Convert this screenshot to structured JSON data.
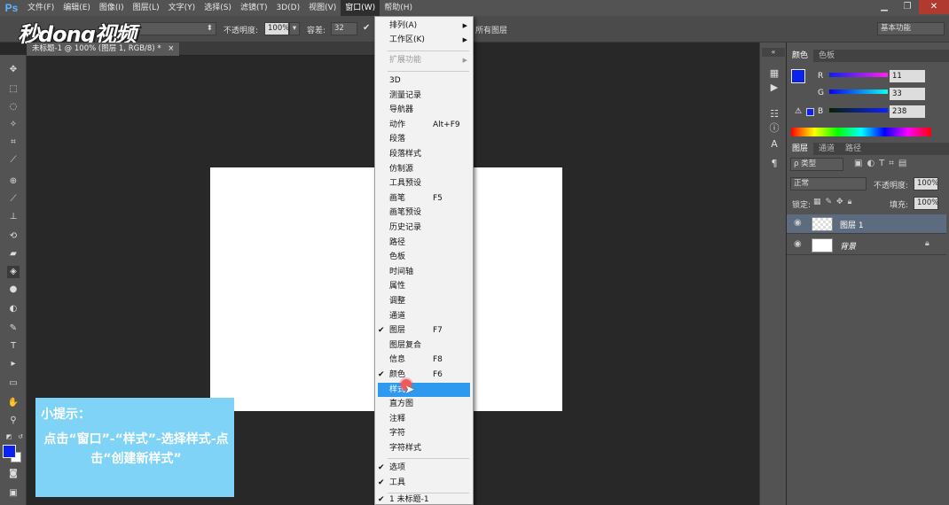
{
  "menubar": {
    "logo": "Ps",
    "items": [
      "文件(F)",
      "编辑(E)",
      "图像(I)",
      "图层(L)",
      "文字(Y)",
      "选择(S)",
      "滤镜(T)",
      "3D(D)",
      "视图(V)",
      "窗口(W)",
      "帮助(H)"
    ],
    "window_controls": [
      "▁",
      "❐",
      "✕"
    ]
  },
  "watermark": "秒dong视频",
  "options": {
    "opacity_label": "不透明度:",
    "opacity_value": "100%",
    "tolerance_label": "容差:",
    "tolerance_value": "32",
    "all_layers_label": "所有图层",
    "workspace": "基本功能"
  },
  "doc_tab": "未标题-1 @ 100% (图层 1, RGB/8) *",
  "tip": {
    "title": "小提示：",
    "body": "点击“窗口”-“样式”-选择样式-点击“创建新样式”"
  },
  "window_menu": {
    "arrange": "排列(A)",
    "workspace": "工作区(K)",
    "extensions": "扩展功能",
    "items": [
      {
        "label": "3D",
        "shortcut": "",
        "checked": false
      },
      {
        "label": "测量记录",
        "shortcut": "",
        "checked": false
      },
      {
        "label": "导航器",
        "shortcut": "",
        "checked": false
      },
      {
        "label": "动作",
        "shortcut": "Alt+F9",
        "checked": false
      },
      {
        "label": "段落",
        "shortcut": "",
        "checked": false
      },
      {
        "label": "段落样式",
        "shortcut": "",
        "checked": false
      },
      {
        "label": "仿制源",
        "shortcut": "",
        "checked": false
      },
      {
        "label": "工具预设",
        "shortcut": "",
        "checked": false
      },
      {
        "label": "画笔",
        "shortcut": "F5",
        "checked": false
      },
      {
        "label": "画笔预设",
        "shortcut": "",
        "checked": false
      },
      {
        "label": "历史记录",
        "shortcut": "",
        "checked": false
      },
      {
        "label": "路径",
        "shortcut": "",
        "checked": false
      },
      {
        "label": "色板",
        "shortcut": "",
        "checked": false
      },
      {
        "label": "时间轴",
        "shortcut": "",
        "checked": false
      },
      {
        "label": "属性",
        "shortcut": "",
        "checked": false
      },
      {
        "label": "调整",
        "shortcut": "",
        "checked": false
      },
      {
        "label": "通道",
        "shortcut": "",
        "checked": false
      },
      {
        "label": "图层",
        "shortcut": "F7",
        "checked": true
      },
      {
        "label": "图层复合",
        "shortcut": "",
        "checked": false
      },
      {
        "label": "信息",
        "shortcut": "F8",
        "checked": false
      },
      {
        "label": "颜色",
        "shortcut": "F6",
        "checked": true
      },
      {
        "label": "样式",
        "shortcut": "",
        "checked": false,
        "highlighted": true
      },
      {
        "label": "直方图",
        "shortcut": "",
        "checked": false
      },
      {
        "label": "注释",
        "shortcut": "",
        "checked": false
      },
      {
        "label": "字符",
        "shortcut": "",
        "checked": false
      },
      {
        "label": "字符样式",
        "shortcut": "",
        "checked": false
      }
    ],
    "options": "选项",
    "tools": "工具",
    "doc": "1 未标题-1"
  },
  "color_panel": {
    "tabs": [
      "颜色",
      "色板"
    ],
    "r_label": "R",
    "r_value": "11",
    "g_label": "G",
    "g_value": "33",
    "b_label": "B",
    "b_value": "238",
    "fg_color": "#0b21ee"
  },
  "layers_panel": {
    "tabs": [
      "图层",
      "通道",
      "路径"
    ],
    "filter": "ρ 类型",
    "blend": "正常",
    "opacity_label": "不透明度:",
    "opacity_value": "100%",
    "lock_label": "锁定:",
    "fill_label": "填充:",
    "fill_value": "100%",
    "layers": [
      {
        "name": "图层 1",
        "selected": true
      },
      {
        "name": "背景",
        "selected": false
      }
    ]
  }
}
